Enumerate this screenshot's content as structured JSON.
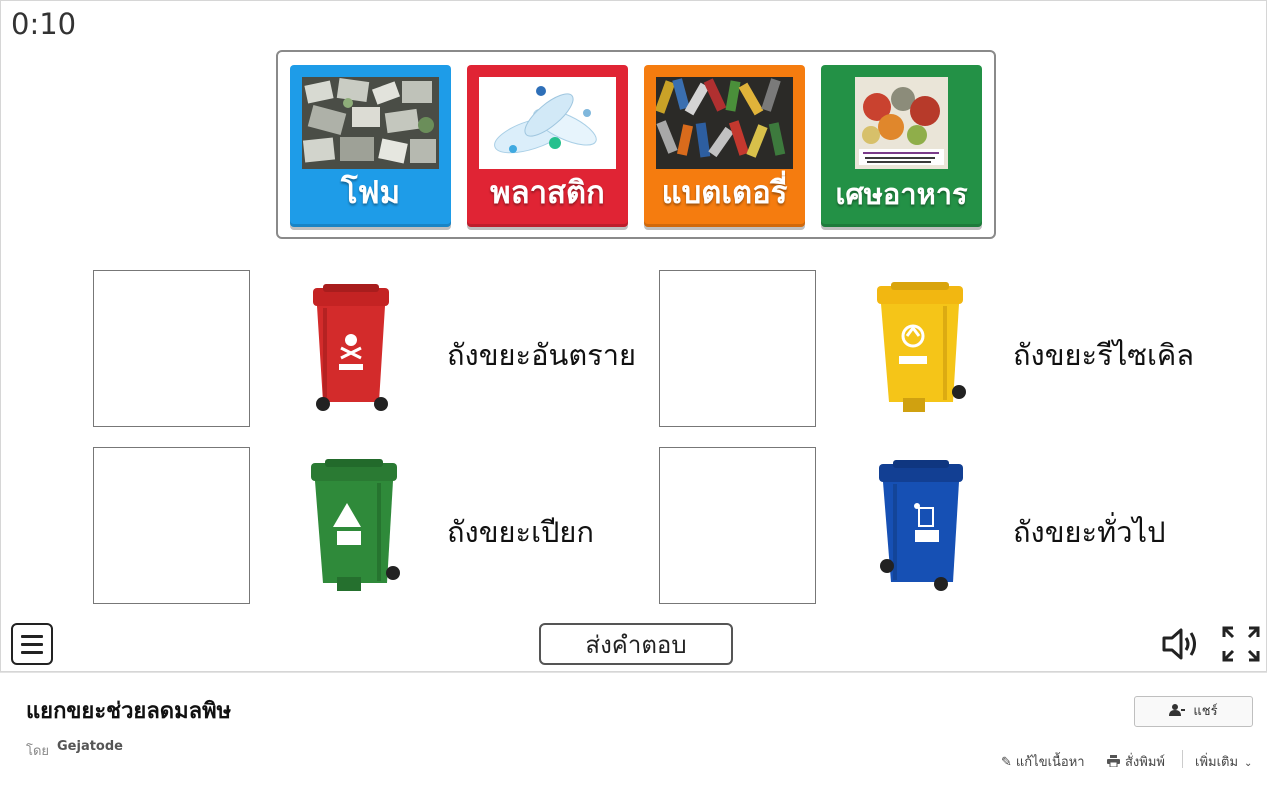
{
  "timer": "0:10",
  "cards": [
    {
      "label": "โฟม",
      "color": "#1e9ce8"
    },
    {
      "label": "พลาสติก",
      "color": "#e02434"
    },
    {
      "label": "แบตเตอรี่",
      "color": "#f57c0f"
    },
    {
      "label": "เศษอาหาร",
      "color": "#239146"
    }
  ],
  "bins": [
    {
      "label": "ถังขยะอันตราย",
      "color": "#d32b2b"
    },
    {
      "label": "ถังขยะรีไซเคิล",
      "color": "#f5c518"
    },
    {
      "label": "ถังขยะเปียก",
      "color": "#2f8a3a"
    },
    {
      "label": "ถังขยะทั่วไป",
      "color": "#1650b4"
    }
  ],
  "controls": {
    "submit": "ส่งคำตอบ",
    "menu_icon": "hamburger-menu-icon",
    "sound_icon": "speaker-icon",
    "fullscreen_icon": "fullscreen-icon"
  },
  "footer": {
    "title": "แยกขยะช่วยลดมลพิษ",
    "by_label": "โดย",
    "author": "Gejatode",
    "share": "แชร์",
    "edit": "แก้ไขเนื้อหา",
    "print": "สั่งพิมพ์",
    "more": "เพิ่มเติม"
  }
}
